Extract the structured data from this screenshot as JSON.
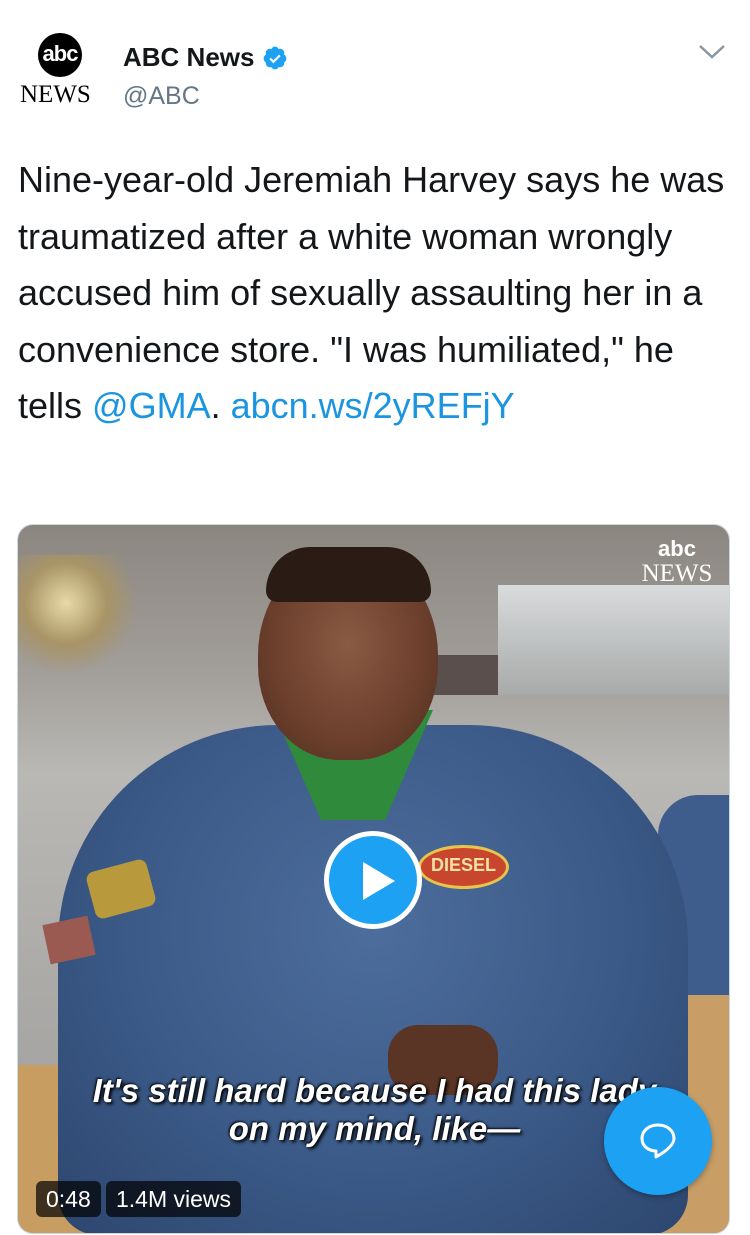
{
  "account": {
    "display_name": "ABC News",
    "handle": "@ABC",
    "avatar_logo_top": "abc",
    "avatar_logo_bottom": "NEWS"
  },
  "tweet": {
    "text_plain": "Nine-year-old Jeremiah Harvey says he was traumatized after a white woman wrongly accused him of sexually assaulting her in a convenience store. \"I was humiliated,\" he tells ",
    "mention": "@GMA",
    "separator": ". ",
    "link": "abcn.ws/2yREFjY"
  },
  "media": {
    "logo_top": "abc",
    "logo_bottom": "NEWS",
    "patch_text": "DIESEL",
    "caption_line1": "It's still hard because I had this lady",
    "caption_line2": "on my mind, like—",
    "duration": "0:48",
    "views": "1.4M views"
  },
  "icons": {
    "verified": "verified-badge-icon",
    "chevron": "chevron-down-icon",
    "play": "play-icon",
    "reply": "reply-icon"
  },
  "colors": {
    "accent": "#1da1f2",
    "link": "#1b95e0",
    "text": "#14171a",
    "secondary": "#657786"
  }
}
